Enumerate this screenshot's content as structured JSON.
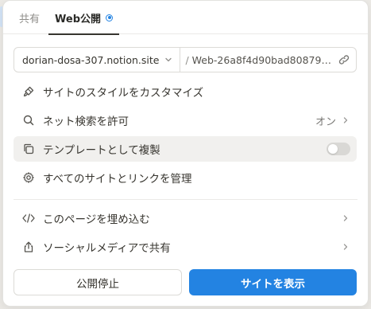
{
  "tabs": [
    {
      "label": "共有",
      "active": false
    },
    {
      "label": "Web公開",
      "active": true
    }
  ],
  "url": {
    "domain": "dorian-dosa-307.notion.site",
    "separator": "/",
    "slug": "Web-26a8f4d90bad80879f..."
  },
  "menu": {
    "customize_label": "サイトのスタイルをカスタマイズ",
    "search_label": "ネット検索を許可",
    "search_value": "オン",
    "duplicate_label": "テンプレートとして複製",
    "duplicate_enabled": false,
    "manage_label": "すべてのサイトとリンクを管理",
    "embed_label": "このページを埋め込む",
    "social_label": "ソーシャルメディアで共有"
  },
  "buttons": {
    "unpublish_label": "公開停止",
    "view_site_label": "サイトを表示"
  },
  "colors": {
    "accent": "#2383e2"
  }
}
